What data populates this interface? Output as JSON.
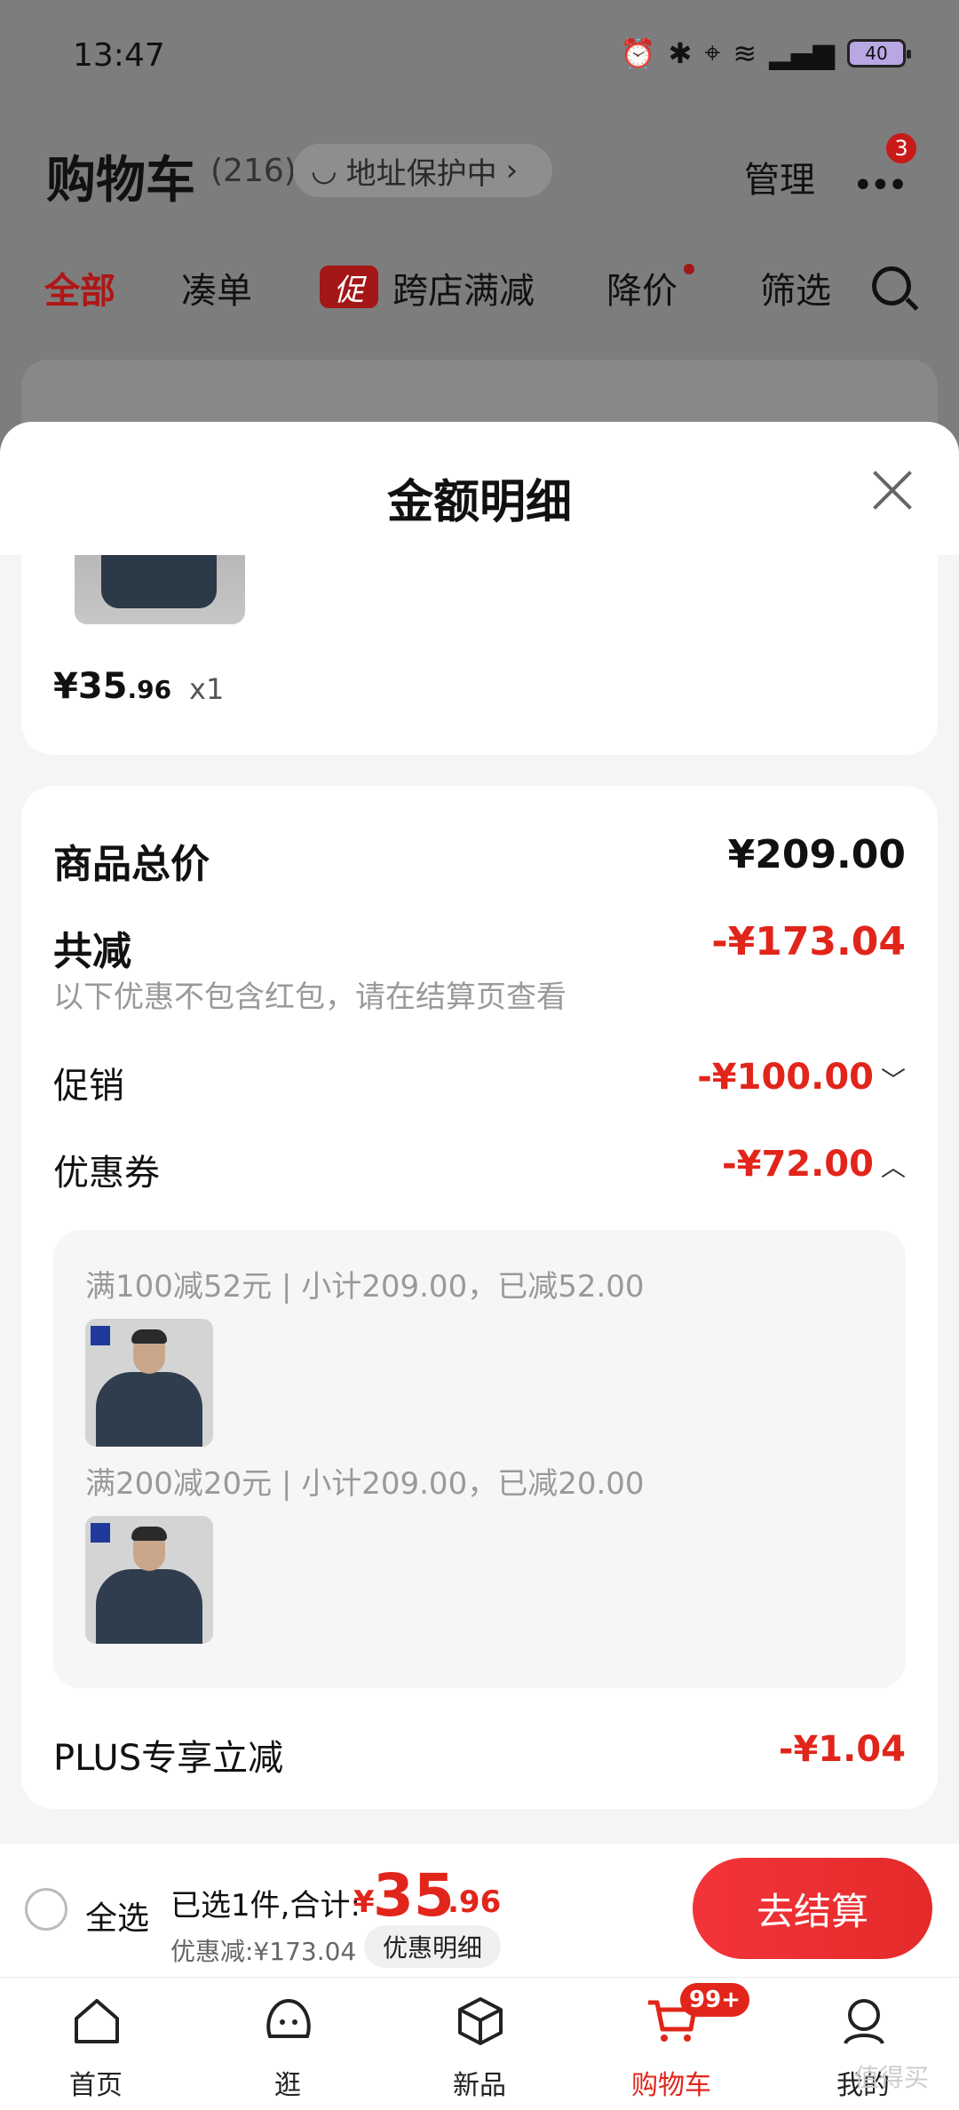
{
  "status_bar": {
    "time": "13:47",
    "battery": "40"
  },
  "header": {
    "title": "购物车",
    "count": "(216)",
    "address_pill": "地址保护中",
    "manage": "管理",
    "message_badge": "3"
  },
  "filter_tabs": [
    "全部",
    "凑单",
    "跨店满减",
    "降价",
    "筛选"
  ],
  "promo_badge": "促",
  "sheet": {
    "title": "金额明细",
    "product": {
      "price_int": "¥35",
      "price_dec": ".96",
      "qty": "x1"
    },
    "summary": {
      "goods_total_label": "商品总价",
      "goods_total_value": "¥209.00",
      "discount_label": "共减",
      "discount_value": "-¥173.04",
      "note": "以下优惠不包含红包，请在结算页查看",
      "promo_label": "促销",
      "promo_value": "-¥100.00",
      "coupon_label": "优惠券",
      "coupon_value": "-¥72.00",
      "coupon_lines": [
        "满100减52元 | 小计209.00，已减52.00",
        "满200减20元 | 小计209.00，已减20.00"
      ],
      "plus_label": "PLUS专享立减",
      "plus_value": "-¥1.04"
    }
  },
  "checkout": {
    "select_all": "全选",
    "selected": "已选1件,合计:",
    "total_symbol": "¥",
    "total_int": "35",
    "total_dec": ".96",
    "discount_text": "优惠减:¥173.04",
    "detail_button": "优惠明细",
    "checkout_button": "去结算"
  },
  "tabbar": [
    {
      "label": "首页",
      "icon": "home-icon"
    },
    {
      "label": "逛",
      "icon": "explore-icon"
    },
    {
      "label": "新品",
      "icon": "cube-icon"
    },
    {
      "label": "购物车",
      "icon": "cart-icon"
    },
    {
      "label": "我的",
      "icon": "user-icon"
    }
  ],
  "cart_badge": "99+",
  "watermark": "值得买",
  "colors": {
    "accent": "#e1251b",
    "sheet_bg": "#f5f5f5",
    "overlay": "#7d7d7d"
  }
}
